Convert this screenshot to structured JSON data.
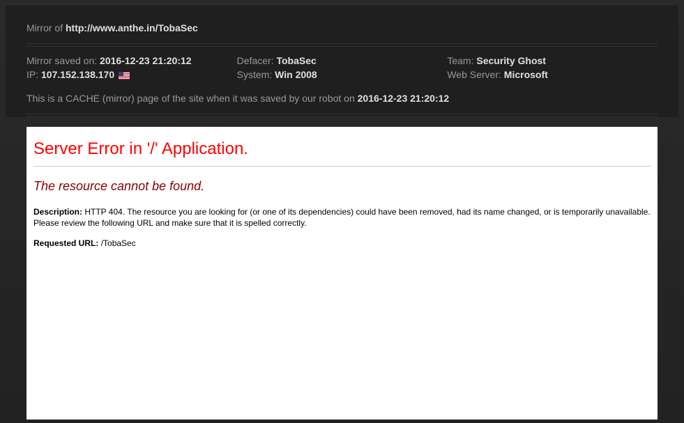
{
  "header": {
    "mirror_of_label": "Mirror of ",
    "mirror_url": "http://www.anthe.in/TobaSec",
    "info": {
      "saved_label": "Mirror saved on: ",
      "saved_value": "2016-12-23 21:20:12",
      "ip_label": "IP: ",
      "ip_value": "107.152.138.170",
      "defacer_label": "Defacer: ",
      "defacer_value": "TobaSec",
      "system_label": "System: ",
      "system_value": "Win 2008",
      "team_label": "Team: ",
      "team_value": "Security Ghost",
      "webserver_label": "Web Server: ",
      "webserver_value": "Microsoft"
    },
    "cache_note_pre": "This is a CACHE (mirror) page of the site when it was saved by our robot on ",
    "cache_note_date": "2016-12-23 21:20:12"
  },
  "error": {
    "h1": "Server Error in '/' Application.",
    "h2": "The resource cannot be found.",
    "desc_label": "Description: ",
    "desc_text": "HTTP 404. The resource you are looking for (or one of its dependencies) could have been removed, had its name changed, or is temporarily unavailable.  Please review the following URL and make sure that it is spelled correctly.",
    "req_label": "Requested URL: ",
    "req_value": "/TobaSec"
  }
}
